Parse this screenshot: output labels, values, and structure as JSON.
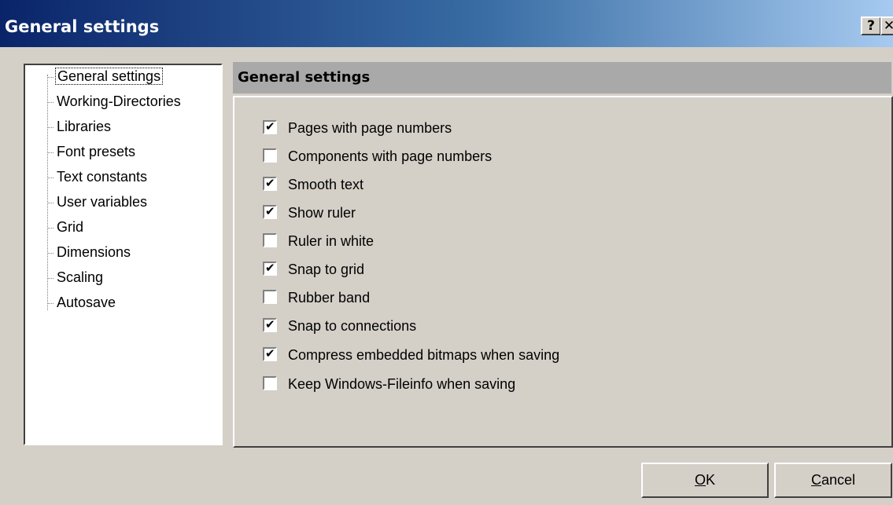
{
  "window": {
    "title": "General settings",
    "help_label": "?",
    "close_label": "✕"
  },
  "tree": {
    "items": [
      {
        "label": "General settings",
        "selected": true
      },
      {
        "label": "Working-Directories"
      },
      {
        "label": "Libraries"
      },
      {
        "label": "Font presets"
      },
      {
        "label": "Text constants"
      },
      {
        "label": "User variables"
      },
      {
        "label": "Grid"
      },
      {
        "label": "Dimensions"
      },
      {
        "label": "Scaling"
      },
      {
        "label": "Autosave"
      }
    ]
  },
  "panel": {
    "header": "General settings",
    "options": [
      {
        "label": "Pages with page numbers",
        "checked": true,
        "mark": "✔"
      },
      {
        "label": "Components with page numbers",
        "checked": false,
        "mark": ""
      },
      {
        "label": "Smooth text",
        "checked": true,
        "mark": "✔"
      },
      {
        "label": "Show ruler",
        "checked": true,
        "mark": "✔"
      },
      {
        "label": "Ruler in white",
        "checked": false,
        "mark": ""
      },
      {
        "label": "Snap to grid",
        "checked": true,
        "mark": "✔"
      },
      {
        "label": "Rubber band",
        "checked": false,
        "mark": ""
      },
      {
        "label": "Snap to connections",
        "checked": true,
        "mark": "✔"
      },
      {
        "label": "Compress embedded bitmaps when saving",
        "checked": true,
        "mark": "✔"
      },
      {
        "label": "Keep Windows-Fileinfo when saving",
        "checked": false,
        "mark": ""
      }
    ]
  },
  "buttons": {
    "ok_mnemonic": "O",
    "ok_rest": "K",
    "cancel_mnemonic": "C",
    "cancel_rest": "ancel"
  }
}
